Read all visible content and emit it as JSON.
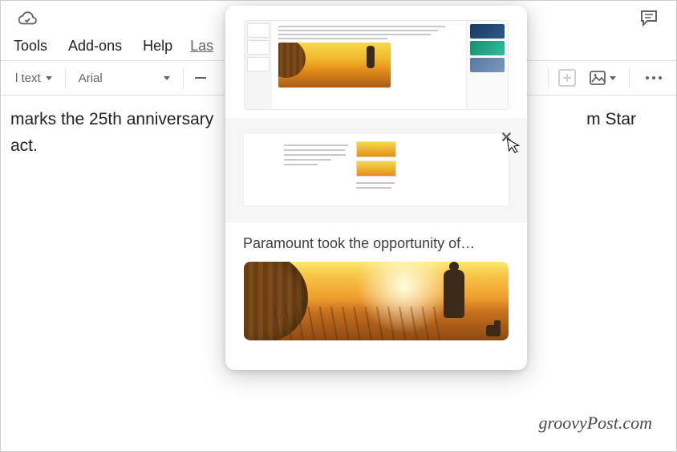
{
  "menu": {
    "tools": "Tools",
    "addons": "Add-ons",
    "help": "Help",
    "last_edit": "Las"
  },
  "toolbar": {
    "style_label": "l text",
    "font_label": "Arial"
  },
  "doc": {
    "line1_left": "marks the 25th anniversary",
    "line1_right": "m Star",
    "line2_left": "act."
  },
  "preview": {
    "title": "Paramount took the opportunity of…"
  },
  "watermark": "groovyPost.com"
}
